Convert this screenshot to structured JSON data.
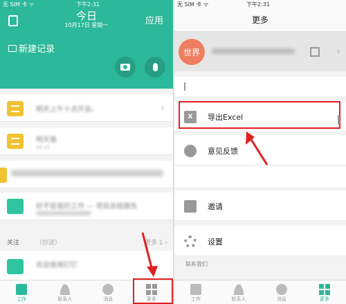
{
  "left": {
    "status_left": "无 SIM 卡 ᯤ",
    "status_time": "下午2:31",
    "status_right": "",
    "title": "今日",
    "date": "10月17日 星期一",
    "apps_label": "应用",
    "new_record_label": "新建记录",
    "cards": [
      {
        "title": "明天上午十点开会。",
        "sub": ""
      },
      {
        "title": "明天做",
        "sub": "10.11"
      },
      {
        "title": "",
        "sub": ""
      },
      {
        "title": "好不容易的工作 — 项目总结报告",
        "sub": ""
      }
    ],
    "follow": {
      "label": "关注",
      "cc": "（抄送）",
      "more": "更多 1 ›"
    },
    "bottom_card_title": "欢迎使用钉钉",
    "tabs": [
      {
        "label": "工作",
        "icon": "doc-icon"
      },
      {
        "label": "联系人",
        "icon": "person-icon"
      },
      {
        "label": "消息",
        "icon": "message-icon"
      },
      {
        "label": "更多",
        "icon": "grid-icon"
      }
    ]
  },
  "right": {
    "status_left": "无 SIM 卡 ᯤ",
    "status_time": "下午2:31",
    "title": "更多",
    "avatar_text": "世界",
    "menu": [
      {
        "label": "导出Excel",
        "icon": "excel-icon"
      },
      {
        "label": "意见反馈",
        "icon": "feedback-icon"
      },
      {
        "label": "邀请",
        "icon": "invite-icon"
      },
      {
        "label": "设置",
        "icon": "gear-icon"
      }
    ],
    "section_label": "联系我们",
    "tabs": [
      {
        "label": "工作",
        "icon": "doc-icon"
      },
      {
        "label": "联系人",
        "icon": "person-icon"
      },
      {
        "label": "消息",
        "icon": "message-icon"
      },
      {
        "label": "更多",
        "icon": "grid-icon"
      }
    ]
  },
  "colors": {
    "accent": "#2cb89a",
    "highlight": "#e02020",
    "note_yellow": "#f1c232"
  }
}
